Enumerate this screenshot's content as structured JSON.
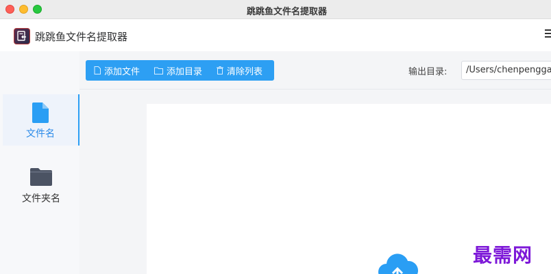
{
  "window": {
    "title": "跳跳鱼文件名提取器"
  },
  "app": {
    "name": "跳跳鱼文件名提取器",
    "logo_icon": "app-logo-icon",
    "menu_icon": "menu-icon"
  },
  "sidebar": {
    "items": [
      {
        "label": "文件名",
        "icon": "file-icon",
        "active": true
      },
      {
        "label": "文件夹名",
        "icon": "folder-icon",
        "active": false
      }
    ]
  },
  "toolbar": {
    "buttons": [
      {
        "label": "添加文件",
        "icon": "document-icon"
      },
      {
        "label": "添加目录",
        "icon": "folder-outline-icon"
      },
      {
        "label": "清除列表",
        "icon": "trash-icon"
      }
    ],
    "output_label": "输出目录:",
    "output_value": "/Users/chenpengga"
  },
  "drop_area": {
    "icon": "cloud-upload-icon"
  },
  "watermark": {
    "text": "最需网"
  },
  "colors": {
    "accent": "#2d9ff3",
    "active_text": "#2a8ae8",
    "watermark": "#7d18d8",
    "traffic_close": "#fe5f57",
    "traffic_min": "#febc2e",
    "traffic_max": "#28c840"
  }
}
